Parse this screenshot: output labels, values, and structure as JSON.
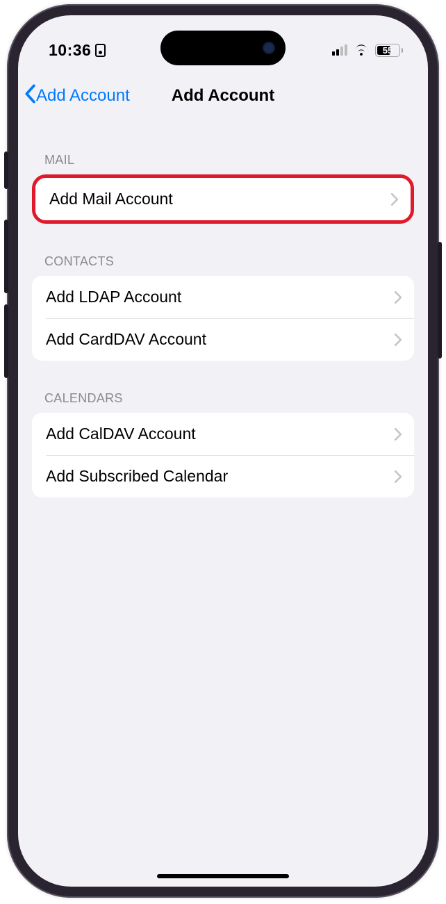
{
  "status": {
    "time": "10:36",
    "battery": "55"
  },
  "nav": {
    "back_label": "Add Account",
    "title": "Add Account"
  },
  "sections": {
    "mail": {
      "header": "MAIL",
      "items": [
        {
          "label": "Add Mail Account"
        }
      ]
    },
    "contacts": {
      "header": "CONTACTS",
      "items": [
        {
          "label": "Add LDAP Account"
        },
        {
          "label": "Add CardDAV Account"
        }
      ]
    },
    "calendars": {
      "header": "CALENDARS",
      "items": [
        {
          "label": "Add CalDAV Account"
        },
        {
          "label": "Add Subscribed Calendar"
        }
      ]
    }
  }
}
